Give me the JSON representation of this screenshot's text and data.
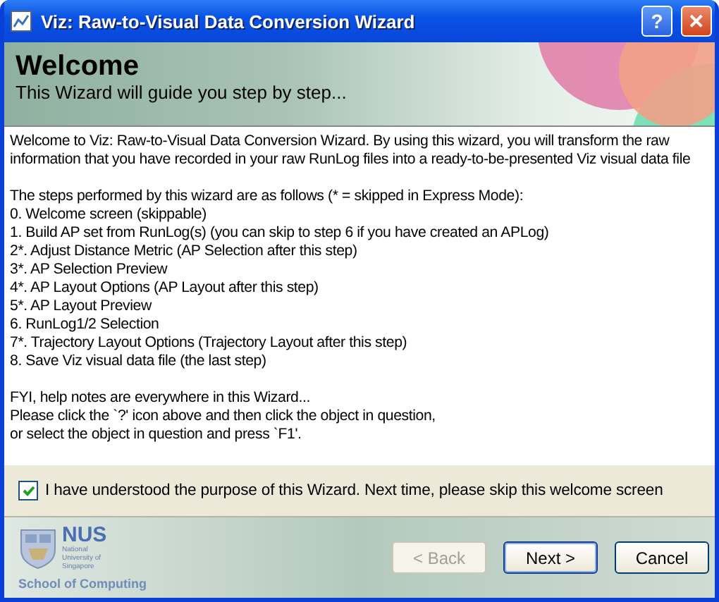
{
  "window": {
    "title": "Viz: Raw-to-Visual Data Conversion Wizard",
    "buttons": [
      {
        "kind": "help",
        "label": "?"
      },
      {
        "kind": "close",
        "label": "✕"
      }
    ]
  },
  "header": {
    "title": "Welcome",
    "subtitle": "This Wizard will guide you step by step..."
  },
  "content": {
    "paragraphs": [
      {
        "lines": [
          "Welcome to Viz: Raw-to-Visual Data Conversion Wizard. By using this wizard, you will transform the raw",
          "information that you have recorded in your raw RunLog files into a ready-to-be-presented Viz visual data file"
        ]
      },
      {
        "lines": [
          "The steps performed by this wizard are as follows (* = skipped in Express Mode):",
          "0. Welcome screen (skippable)",
          "1. Build AP set from RunLog(s) (you can skip to step 6 if you have created an APLog)",
          "2*. Adjust Distance Metric (AP Selection after this step)",
          "3*. AP Selection Preview",
          "4*. AP Layout Options (AP Layout after this step)",
          "5*. AP Layout Preview",
          "6. RunLog1/2 Selection",
          "7*. Trajectory Layout Options (Trajectory Layout after this step)",
          "8. Save Viz visual data file (the last step)"
        ]
      },
      {
        "lines": [
          "FYI, help notes are everywhere in this Wizard...",
          "Please click the `?' icon above and then click the object in question,",
          "or select the object in question and press `F1'."
        ]
      }
    ]
  },
  "skip_checkbox": {
    "label": "I have understood the purpose of this Wizard. Next time, please skip this welcome screen",
    "checked": true
  },
  "logo": {
    "name": "NUS",
    "tagline": "National University of Singapore",
    "school": "School of Computing"
  },
  "buttons": [
    {
      "label": "< Back",
      "disabled": true,
      "default": false
    },
    {
      "label": "Next >",
      "disabled": false,
      "default": true
    },
    {
      "label": "Cancel",
      "disabled": false,
      "default": false
    }
  ]
}
